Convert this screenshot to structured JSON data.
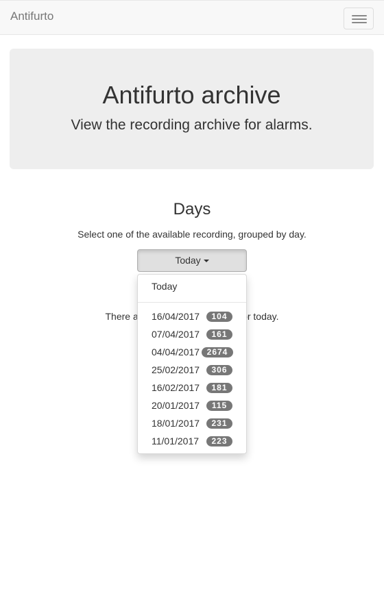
{
  "navbar": {
    "brand": "Antifurto",
    "toggle_icon": "hamburger-menu-icon"
  },
  "jumbotron": {
    "title": "Antifurto archive",
    "subtitle": "View the recording archive for alarms."
  },
  "days": {
    "title": "Days",
    "description": "Select one of the available recording, grouped by day.",
    "dropdown": {
      "selected": "Today",
      "caret_icon": "caret-down-icon",
      "header_item": "Today",
      "items": [
        {
          "date": "16/04/2017",
          "count": "104"
        },
        {
          "date": "07/04/2017",
          "count": "161"
        },
        {
          "date": "04/04/2017",
          "count": "2674"
        },
        {
          "date": "25/02/2017",
          "count": "306"
        },
        {
          "date": "16/02/2017",
          "count": "181"
        },
        {
          "date": "20/01/2017",
          "count": "115"
        },
        {
          "date": "18/01/2017",
          "count": "231"
        },
        {
          "date": "11/01/2017",
          "count": "223"
        }
      ]
    },
    "info_before": "There are",
    "info_after": "for today."
  },
  "colors": {
    "navbar_bg": "#f8f8f8",
    "jumbotron_bg": "#eeeeee",
    "badge_bg": "#777777",
    "button_active_bg": "#e0e0e0"
  }
}
